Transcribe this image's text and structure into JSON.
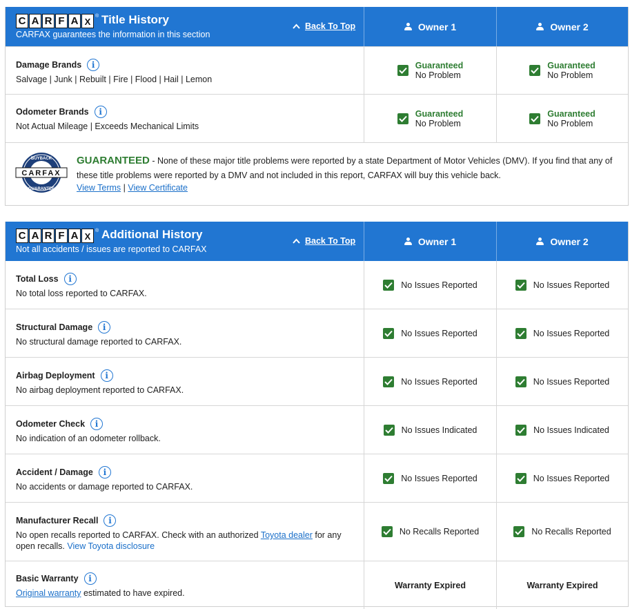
{
  "title_history": {
    "title": "Title History",
    "subtitle": "CARFAX guarantees the information in this section",
    "back_to_top": "Back To Top",
    "owners": [
      "Owner 1",
      "Owner 2"
    ],
    "rows": [
      {
        "title": "Damage Brands",
        "desc": "Salvage | Junk | Rebuilt | Fire | Flood | Hail | Lemon",
        "status_title": "Guaranteed",
        "status_text": "No Problem"
      },
      {
        "title": "Odometer Brands",
        "desc": "Not Actual Mileage | Exceeds Mechanical Limits",
        "status_title": "Guaranteed",
        "status_text": "No Problem"
      }
    ],
    "guarantee": {
      "headline": "GUARANTEED",
      "text": " - None of these major title problems were reported by a state Department of Motor Vehicles (DMV). If you find that any of these title problems were reported by a DMV and not included in this report, CARFAX will buy this vehicle back.",
      "view_terms": "View Terms",
      "separator": "|",
      "view_certificate": "View Certificate",
      "badge_top": "BUYBACK",
      "badge_bottom": "GUARANTEE"
    }
  },
  "additional_history": {
    "title": "Additional History",
    "subtitle": "Not all accidents / issues are reported to CARFAX",
    "back_to_top": "Back To Top",
    "owners": [
      "Owner 1",
      "Owner 2"
    ],
    "rows": [
      {
        "title": "Total Loss",
        "desc": "No total loss reported to CARFAX.",
        "status": "No Issues Reported"
      },
      {
        "title": "Structural Damage",
        "desc": "No structural damage reported to CARFAX.",
        "status": "No Issues Reported"
      },
      {
        "title": "Airbag Deployment",
        "desc": "No airbag deployment reported to CARFAX.",
        "status": "No Issues Reported"
      },
      {
        "title": "Odometer Check",
        "desc": "No indication of an odometer rollback.",
        "status": "No Issues Indicated"
      },
      {
        "title": "Accident / Damage",
        "desc": "No accidents or damage reported to CARFAX.",
        "status": "No Issues Reported"
      }
    ],
    "recall": {
      "title": "Manufacturer Recall",
      "desc_1": "No open recalls reported to CARFAX. Check with an authorized ",
      "dealer_link": "Toyota dealer",
      "desc_2": " for any open recalls. ",
      "disclosure_link": "View Toyota disclosure",
      "status": "No Recalls Reported"
    },
    "warranty": {
      "title": "Basic Warranty",
      "link": "Original warranty",
      "desc": " estimated to have expired.",
      "status": "Warranty Expired"
    }
  },
  "logo_letters": [
    "C",
    "A",
    "R",
    "F",
    "A",
    "X"
  ],
  "colors": {
    "header_blue": "#2176d2",
    "check_green": "#2e7d32",
    "link_blue": "#1a6fc9"
  }
}
